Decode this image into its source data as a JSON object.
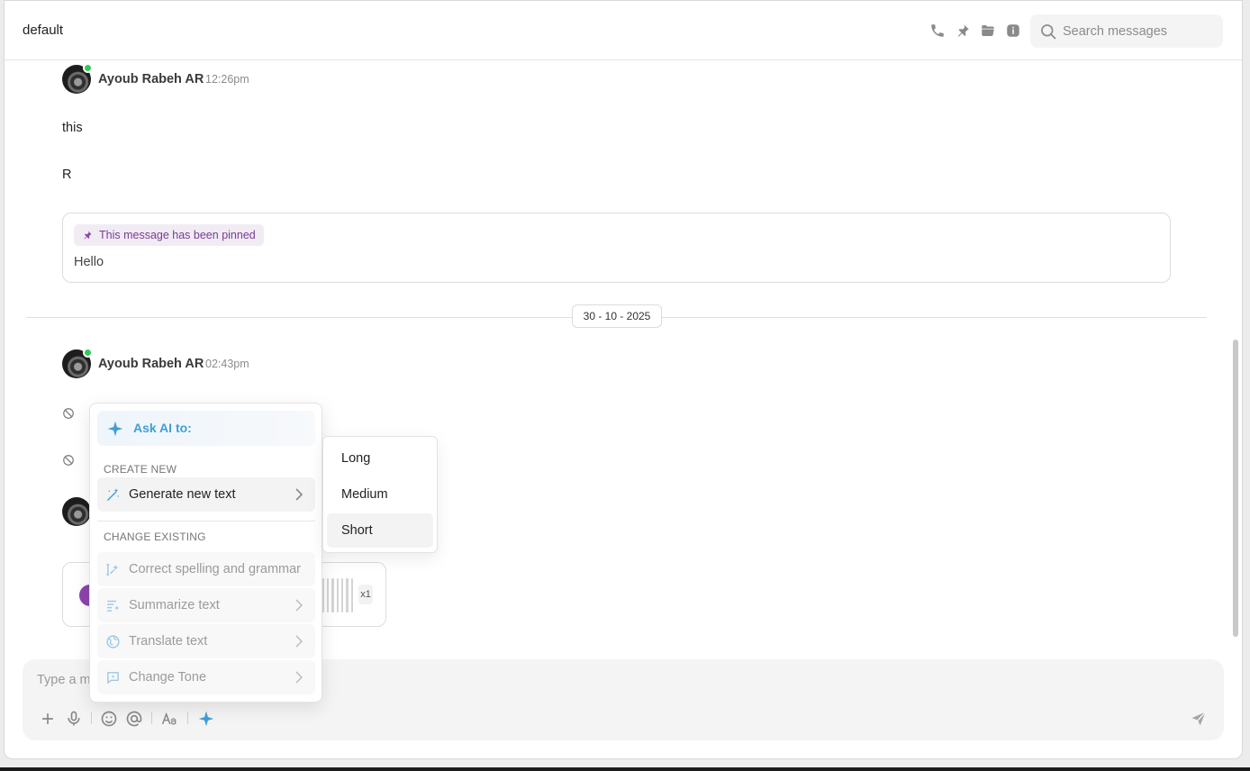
{
  "header": {
    "channel_name": "default",
    "icons": [
      "phone-icon",
      "pin-icon",
      "folder-icon",
      "info-icon"
    ],
    "search_placeholder": "Search messages"
  },
  "messages": [
    {
      "author": "Ayoub Rabeh AR",
      "time": "12:26pm",
      "lines": [
        "this",
        "R"
      ],
      "pinned": {
        "badge": "This message has been pinned",
        "text": "Hello"
      }
    },
    {
      "author": "Ayoub Rabeh AR",
      "time": "02:43pm"
    }
  ],
  "date_separator": "30 - 10 - 2025",
  "voice_message": {
    "speed": "x1"
  },
  "composer": {
    "placeholder": "Type a message...",
    "tools": [
      "plus-icon",
      "mic-icon",
      "emoji-icon",
      "mention-icon",
      "format-text-icon",
      "ai-sparkle-icon"
    ],
    "send_icon": "send-icon"
  },
  "ai_menu": {
    "header": "Ask AI to:",
    "create_section": "CREATE NEW",
    "create_items": [
      {
        "label": "Generate new text",
        "icon": "magic-wand-icon"
      }
    ],
    "change_section": "CHANGE EXISTING",
    "change_items": [
      {
        "label": "Correct spelling and grammar",
        "icon": "spell-check-icon"
      },
      {
        "label": "Summarize text",
        "icon": "summarize-icon"
      },
      {
        "label": "Translate text",
        "icon": "globe-icon"
      },
      {
        "label": "Change Tone",
        "icon": "chat-sparkle-icon"
      }
    ],
    "length_options": [
      "Long",
      "Medium",
      "Short"
    ],
    "highlighted_option": "Short"
  },
  "colors": {
    "accent_ai": "#3f9fd6",
    "pinned_text": "#7a3b96",
    "online": "#2ecc5a",
    "voice_avatar": "#8e44ad"
  }
}
